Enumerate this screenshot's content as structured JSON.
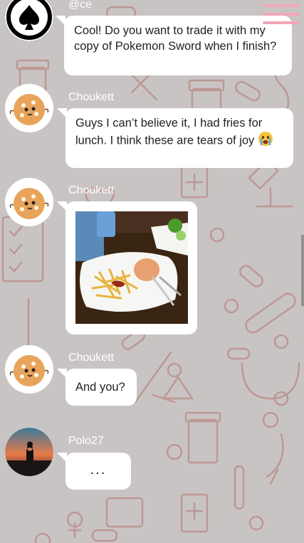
{
  "colors": {
    "background": "#c9c4c4",
    "pattern": "#b88a84",
    "bubble": "#ffffff",
    "name": "#ffffff",
    "menu_accent": "#f2a7b8"
  },
  "menu": {
    "icon": "hamburger-menu-icon"
  },
  "messages": [
    {
      "sender": "@ce",
      "avatar_icon": "spade-avatar-icon",
      "text": "Cool! Do you want to trade it with my copy of Pokemon Sword when I finish?"
    },
    {
      "sender": "Choukett",
      "avatar_icon": "cookie-avatar-icon",
      "text": "Guys I can’t believe it, I had fries for lunch. I think these are tears of joy",
      "emoji": "crying-face-emoji"
    },
    {
      "sender": "Choukett",
      "avatar_icon": "cookie-avatar-icon",
      "image": "fries-lunch-photo"
    },
    {
      "sender": "Choukett",
      "avatar_icon": "cookie-avatar-icon",
      "text": "And you?"
    },
    {
      "sender": "Polo27",
      "avatar_icon": "sunset-silhouette-avatar-icon",
      "text": "..."
    }
  ]
}
